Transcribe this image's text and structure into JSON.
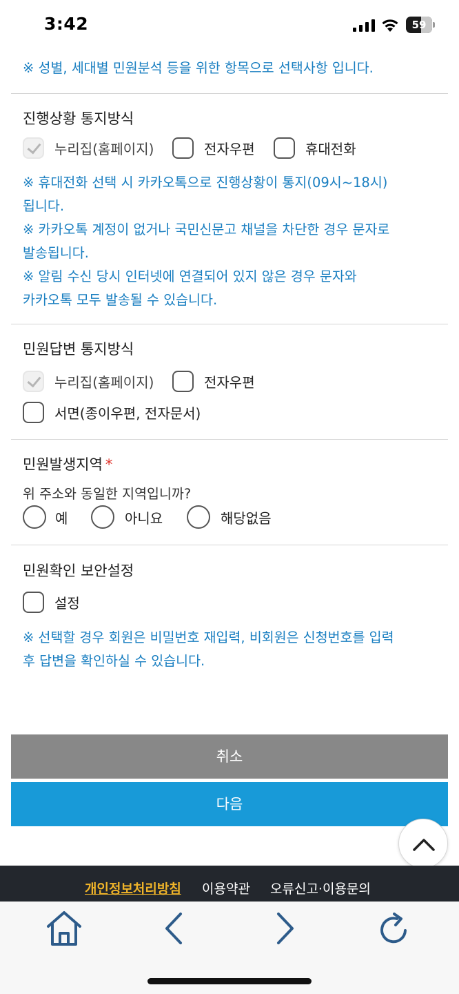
{
  "status_bar": {
    "time": "3:42",
    "battery": "59",
    "battery_level": 0.59
  },
  "notes": {
    "privacy_note": "※ 성별, 세대별 민원분석 등을 위한 항목으로 선택사항 입니다.",
    "progress_notes": [
      "※ 휴대전화 선택 시 카카오톡으로 진행상황이 통지(09시~18시)",
      "됩니다.",
      "※ 카카오톡 계정이 없거나 국민신문고 채널을 차단한 경우 문자로",
      "발송됩니다.",
      "※ 알림 수신 당시 인터넷에 연결되어 있지 않은 경우 문자와",
      "카카오톡 모두 발송될 수 있습니다."
    ],
    "security_notes": [
      "※ 선택할 경우 회원은 비밀번호 재입력, 비회원은 신청번호를 입력",
      "후 답변을 확인하실 수 있습니다."
    ]
  },
  "progress_notify": {
    "title": "진행상황 통지방식",
    "options": [
      {
        "label": "누리집(홈페이지)",
        "checked": true,
        "disabled": true
      },
      {
        "label": "전자우편",
        "checked": false
      },
      {
        "label": "휴대전화",
        "checked": false
      }
    ]
  },
  "answer_notify": {
    "title": "민원답변 통지방식",
    "options": [
      {
        "label": "누리집(홈페이지)",
        "checked": true,
        "disabled": true
      },
      {
        "label": "전자우편",
        "checked": false
      },
      {
        "label": "서면(종이우편, 전자문서)",
        "checked": false
      }
    ]
  },
  "region": {
    "title": "민원발생지역",
    "required_mark": "*",
    "question": "위 주소와 동일한 지역입니까?",
    "options": [
      "예",
      "아니요",
      "해당없음"
    ]
  },
  "security": {
    "title": "민원확인 보안설정",
    "option": "설정"
  },
  "buttons": {
    "cancel": "취소",
    "next": "다음"
  },
  "footer": {
    "links": [
      "개인정보처리방침",
      "이용약관",
      "오류신고·이용문의"
    ]
  },
  "colors": {
    "note_blue": "#1a7fc1",
    "next_button": "#189ad8",
    "cancel_button": "#888888",
    "footer_highlight": "#f0b429"
  },
  "icons": [
    "home-icon",
    "back-icon",
    "forward-icon",
    "reload-icon",
    "chevron-up-icon"
  ]
}
